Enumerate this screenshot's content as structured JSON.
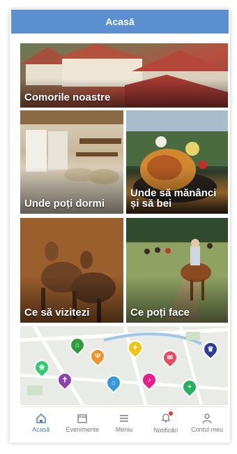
{
  "header": {
    "title": "Acasă"
  },
  "tiles": [
    {
      "label": "Comorile noastre"
    },
    {
      "label": "Unde poți dormi"
    },
    {
      "label": "Unde să mănânci și să bei"
    },
    {
      "label": "Ce să vizitezi"
    },
    {
      "label": "Ce poți face"
    }
  ],
  "nav": {
    "items": [
      {
        "label": "Acasă",
        "icon": "home-icon",
        "active": true
      },
      {
        "label": "Evenimente",
        "icon": "calendar-icon"
      },
      {
        "label": "Meniu",
        "icon": "menu-icon"
      },
      {
        "label": "Notificări",
        "icon": "bell-icon",
        "badge": true
      },
      {
        "label": "Contul meu",
        "icon": "user-icon"
      }
    ]
  },
  "colors": {
    "accent": "#5b8fd0",
    "nav_active": "#4d7fc4",
    "badge": "#e53935"
  },
  "map_pins": [
    {
      "icon": "bed-icon",
      "color": "#2e9e3a"
    },
    {
      "icon": "restaurant-icon",
      "color": "#f0932b"
    },
    {
      "icon": "lightbulb-icon",
      "color": "#f1c40f"
    },
    {
      "icon": "mail-icon",
      "color": "#e84a5f"
    },
    {
      "icon": "crown-icon",
      "color": "#2c3e99"
    },
    {
      "icon": "spa-icon",
      "color": "#2ecc71"
    },
    {
      "icon": "church-icon",
      "color": "#8e44ad"
    },
    {
      "icon": "house-icon",
      "color": "#3498db"
    },
    {
      "icon": "music-icon",
      "color": "#e91e8c"
    },
    {
      "icon": "medical-cross-icon",
      "color": "#27ae60"
    }
  ]
}
